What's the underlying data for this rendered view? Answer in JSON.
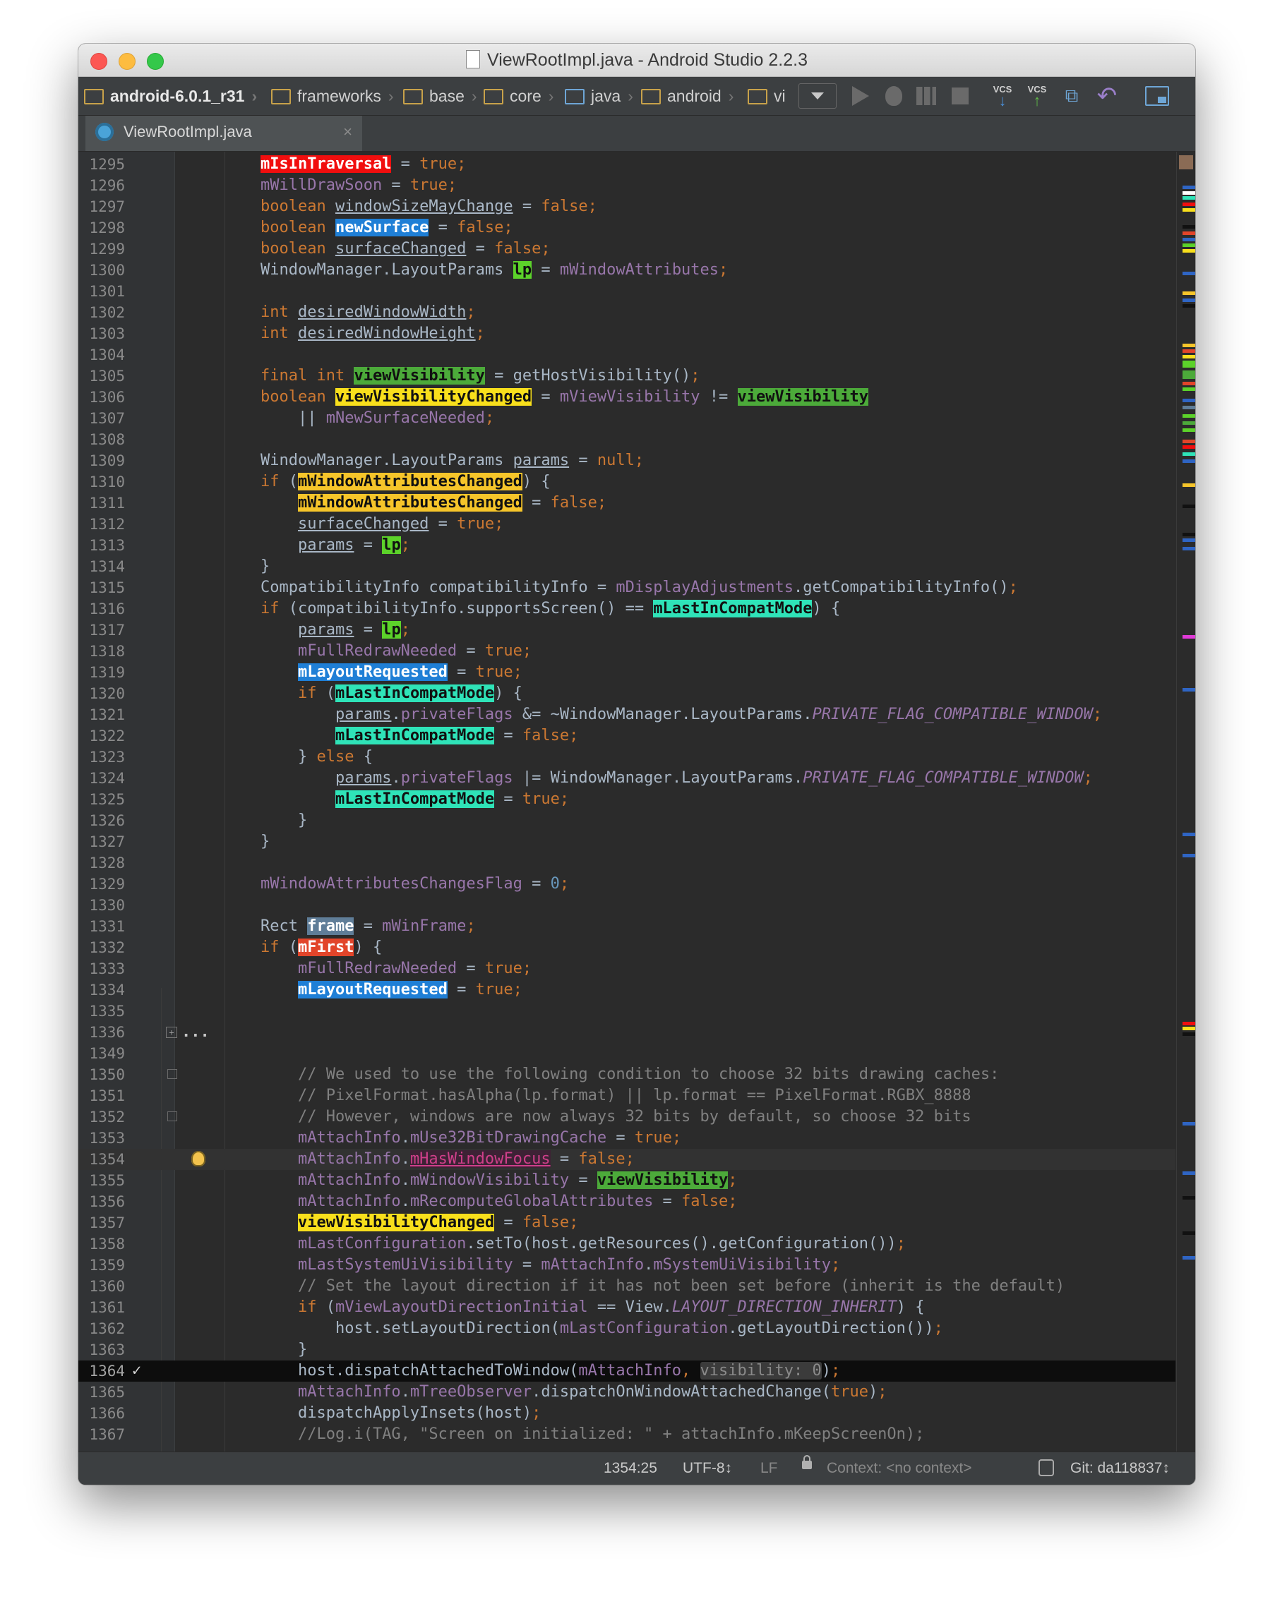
{
  "window": {
    "title": "ViewRootImpl.java - Android Studio 2.2.3"
  },
  "breadcrumbs": [
    {
      "label": "android-6.0.1_r31"
    },
    {
      "label": "frameworks"
    },
    {
      "label": "base"
    },
    {
      "label": "core"
    },
    {
      "label": "java"
    },
    {
      "label": "android"
    },
    {
      "label": "vi"
    }
  ],
  "toolbar": {
    "run_icon": "play-icon",
    "debug_icon": "bug-icon",
    "profile_icon": "profile-icon",
    "stop_icon": "stop-icon",
    "vcs_update": "VCS",
    "vcs_commit": "VCS",
    "history_icon": "history-icon",
    "revert_icon": "undo-icon",
    "structure_icon": "project-structure-icon"
  },
  "tab": {
    "label": "ViewRootImpl.java",
    "close": "×"
  },
  "editor": {
    "gutter_check": "✓",
    "fold_placeholder": "...",
    "lines": [
      {
        "n": "1295",
        "t": [
          [
            "h-red",
            "mIsInTraversal"
          ],
          [
            "",
            " = "
          ],
          [
            "kw",
            "true;"
          ]
        ]
      },
      {
        "n": "1296",
        "t": [
          [
            "fld",
            "mWillDrawSoon"
          ],
          [
            "",
            " = "
          ],
          [
            "kw",
            "true;"
          ]
        ]
      },
      {
        "n": "1297",
        "t": [
          [
            "kw",
            "boolean "
          ],
          [
            "u",
            "windowSizeMayChange"
          ],
          [
            "",
            " = "
          ],
          [
            "kw",
            "false;"
          ]
        ]
      },
      {
        "n": "1298",
        "t": [
          [
            "kw",
            "boolean "
          ],
          [
            "h-blue",
            "newSurface"
          ],
          [
            "",
            " = "
          ],
          [
            "kw",
            "false;"
          ]
        ]
      },
      {
        "n": "1299",
        "t": [
          [
            "kw",
            "boolean "
          ],
          [
            "u",
            "surfaceChanged"
          ],
          [
            "",
            " = "
          ],
          [
            "kw",
            "false;"
          ]
        ]
      },
      {
        "n": "1300",
        "t": [
          [
            "",
            "WindowManager.LayoutParams "
          ],
          [
            "h-lime",
            "lp"
          ],
          [
            "",
            " = "
          ],
          [
            "fld",
            "mWindowAttributes"
          ],
          [
            "kw",
            ";"
          ]
        ]
      },
      {
        "n": "1301",
        "t": []
      },
      {
        "n": "1302",
        "t": [
          [
            "kw",
            "int "
          ],
          [
            "u",
            "desiredWindowWidth"
          ],
          [
            "kw",
            ";"
          ]
        ]
      },
      {
        "n": "1303",
        "t": [
          [
            "kw",
            "int "
          ],
          [
            "u",
            "desiredWindowHeight"
          ],
          [
            "kw",
            ";"
          ]
        ]
      },
      {
        "n": "1304",
        "t": []
      },
      {
        "n": "1305",
        "t": [
          [
            "kw",
            "final int "
          ],
          [
            "h-green",
            "viewVisibility"
          ],
          [
            "",
            " = getHostVisibility()"
          ],
          [
            "kw",
            ";"
          ]
        ]
      },
      {
        "n": "1306",
        "t": [
          [
            "kw",
            "boolean "
          ],
          [
            "h-yellow",
            "viewVisibilityChanged"
          ],
          [
            "",
            " = "
          ],
          [
            "fld",
            "mViewVisibility"
          ],
          [
            "",
            " != "
          ],
          [
            "h-green",
            "viewVisibility"
          ]
        ]
      },
      {
        "n": "1307",
        "t": [
          [
            "",
            "    || "
          ],
          [
            "fld",
            "mNewSurfaceNeeded"
          ],
          [
            "kw",
            ";"
          ]
        ]
      },
      {
        "n": "1308",
        "t": []
      },
      {
        "n": "1309",
        "t": [
          [
            "",
            "WindowManager.LayoutParams "
          ],
          [
            "u",
            "params"
          ],
          [
            "",
            " = "
          ],
          [
            "kw",
            "null;"
          ]
        ]
      },
      {
        "n": "1310",
        "t": [
          [
            "kw",
            "if "
          ],
          [
            "",
            "("
          ],
          [
            "h-orange",
            "mWindowAttributesChanged"
          ],
          [
            "",
            ") {"
          ]
        ]
      },
      {
        "n": "1311",
        "t": [
          [
            "",
            "    "
          ],
          [
            "h-orange",
            "mWindowAttributesChanged"
          ],
          [
            "",
            " = "
          ],
          [
            "kw",
            "false;"
          ]
        ]
      },
      {
        "n": "1312",
        "t": [
          [
            "",
            "    "
          ],
          [
            "u",
            "surfaceChanged"
          ],
          [
            "",
            " = "
          ],
          [
            "kw",
            "true;"
          ]
        ]
      },
      {
        "n": "1313",
        "t": [
          [
            "",
            "    "
          ],
          [
            "u",
            "params"
          ],
          [
            "",
            " = "
          ],
          [
            "h-lime",
            "lp"
          ],
          [
            "kw",
            ";"
          ]
        ]
      },
      {
        "n": "1314",
        "t": [
          [
            "",
            "}"
          ]
        ]
      },
      {
        "n": "1315",
        "t": [
          [
            "",
            "CompatibilityInfo compatibilityInfo = "
          ],
          [
            "fld",
            "mDisplayAdjustments"
          ],
          [
            "",
            ".getCompatibilityInfo()"
          ],
          [
            "kw",
            ";"
          ]
        ]
      },
      {
        "n": "1316",
        "t": [
          [
            "kw",
            "if "
          ],
          [
            "",
            "(compatibilityInfo.supportsScreen() == "
          ],
          [
            "h-aqua",
            "mLastInCompatMode"
          ],
          [
            "",
            ") {"
          ]
        ]
      },
      {
        "n": "1317",
        "t": [
          [
            "",
            "    "
          ],
          [
            "u",
            "params"
          ],
          [
            "",
            " = "
          ],
          [
            "h-lime",
            "lp"
          ],
          [
            "kw",
            ";"
          ]
        ]
      },
      {
        "n": "1318",
        "t": [
          [
            "",
            "    "
          ],
          [
            "fld",
            "mFullRedrawNeeded"
          ],
          [
            "",
            " = "
          ],
          [
            "kw",
            "true;"
          ]
        ]
      },
      {
        "n": "1319",
        "t": [
          [
            "",
            "    "
          ],
          [
            "h-blue",
            "mLayoutRequested"
          ],
          [
            "",
            " = "
          ],
          [
            "kw",
            "true;"
          ]
        ]
      },
      {
        "n": "1320",
        "t": [
          [
            "",
            "    "
          ],
          [
            "kw",
            "if "
          ],
          [
            "",
            "("
          ],
          [
            "h-aqua",
            "mLastInCompatMode"
          ],
          [
            "",
            ") {"
          ]
        ]
      },
      {
        "n": "1321",
        "t": [
          [
            "",
            "        "
          ],
          [
            "u",
            "params"
          ],
          [
            "",
            "."
          ],
          [
            "fld",
            "privateFlags"
          ],
          [
            "",
            " &= ~WindowManager.LayoutParams."
          ],
          [
            "fld ital",
            "PRIVATE_FLAG_COMPATIBLE_WINDOW"
          ],
          [
            "kw",
            ";"
          ]
        ]
      },
      {
        "n": "1322",
        "t": [
          [
            "",
            "        "
          ],
          [
            "h-aqua",
            "mLastInCompatMode"
          ],
          [
            "",
            " = "
          ],
          [
            "kw",
            "false;"
          ]
        ]
      },
      {
        "n": "1323",
        "t": [
          [
            "",
            "    } "
          ],
          [
            "kw",
            "else "
          ],
          [
            "",
            "{"
          ]
        ]
      },
      {
        "n": "1324",
        "t": [
          [
            "",
            "        "
          ],
          [
            "u",
            "params"
          ],
          [
            "",
            "."
          ],
          [
            "fld",
            "privateFlags"
          ],
          [
            "",
            " |= WindowManager.LayoutParams."
          ],
          [
            "fld ital",
            "PRIVATE_FLAG_COMPATIBLE_WINDOW"
          ],
          [
            "kw",
            ";"
          ]
        ]
      },
      {
        "n": "1325",
        "t": [
          [
            "",
            "        "
          ],
          [
            "h-aqua",
            "mLastInCompatMode"
          ],
          [
            "",
            " = "
          ],
          [
            "kw",
            "true;"
          ]
        ]
      },
      {
        "n": "1326",
        "t": [
          [
            "",
            "    }"
          ]
        ]
      },
      {
        "n": "1327",
        "t": [
          [
            "",
            "}"
          ]
        ]
      },
      {
        "n": "1328",
        "t": []
      },
      {
        "n": "1329",
        "t": [
          [
            "fld",
            "mWindowAttributesChangesFlag"
          ],
          [
            "",
            " = "
          ],
          [
            "num",
            "0"
          ],
          [
            "kw",
            ";"
          ]
        ]
      },
      {
        "n": "1330",
        "t": []
      },
      {
        "n": "1331",
        "t": [
          [
            "",
            "Rect "
          ],
          [
            "h-steel",
            "frame"
          ],
          [
            "",
            " = "
          ],
          [
            "fld",
            "mWinFrame"
          ],
          [
            "kw",
            ";"
          ]
        ]
      },
      {
        "n": "1332",
        "t": [
          [
            "kw",
            "if "
          ],
          [
            "",
            "("
          ],
          [
            "h-redorange",
            "mFirst"
          ],
          [
            "",
            ") {"
          ]
        ]
      },
      {
        "n": "1333",
        "t": [
          [
            "",
            "    "
          ],
          [
            "fld",
            "mFullRedrawNeeded"
          ],
          [
            "",
            " = "
          ],
          [
            "kw",
            "true;"
          ]
        ]
      },
      {
        "n": "1334",
        "t": [
          [
            "",
            "    "
          ],
          [
            "h-blue",
            "mLayoutRequested"
          ],
          [
            "",
            " = "
          ],
          [
            "kw",
            "true;"
          ]
        ]
      },
      {
        "n": "1335",
        "t": []
      },
      {
        "n": "1336",
        "t": []
      },
      {
        "n": "1349",
        "t": []
      },
      {
        "n": "1350",
        "t": [
          [
            "",
            "    "
          ],
          [
            "cm",
            "// We used to use the following condition to choose 32 bits drawing caches:"
          ]
        ]
      },
      {
        "n": "1351",
        "t": [
          [
            "",
            "    "
          ],
          [
            "cm",
            "// PixelFormat.hasAlpha(lp.format) || lp.format == PixelFormat.RGBX_8888"
          ]
        ]
      },
      {
        "n": "1352",
        "t": [
          [
            "",
            "    "
          ],
          [
            "cm",
            "// However, windows are now always 32 bits by default, so choose 32 bits"
          ]
        ]
      },
      {
        "n": "1353",
        "t": [
          [
            "",
            "    "
          ],
          [
            "fld",
            "mAttachInfo"
          ],
          [
            "",
            "."
          ],
          [
            "fld",
            "mUse32BitDrawingCache"
          ],
          [
            "",
            " = "
          ],
          [
            "kw",
            "true;"
          ]
        ]
      },
      {
        "n": "1354",
        "t": [
          [
            "",
            "    "
          ],
          [
            "fld",
            "mAttachInfo"
          ],
          [
            "",
            "."
          ],
          [
            "h-magenta",
            "mHasWindowFocus"
          ],
          [
            "",
            " = "
          ],
          [
            "kw",
            "false;"
          ]
        ]
      },
      {
        "n": "1355",
        "t": [
          [
            "",
            "    "
          ],
          [
            "fld",
            "mAttachInfo"
          ],
          [
            "",
            "."
          ],
          [
            "fld",
            "mWindowVisibility"
          ],
          [
            "",
            " = "
          ],
          [
            "h-green",
            "viewVisibility"
          ],
          [
            "kw",
            ";"
          ]
        ]
      },
      {
        "n": "1356",
        "t": [
          [
            "",
            "    "
          ],
          [
            "fld",
            "mAttachInfo"
          ],
          [
            "",
            "."
          ],
          [
            "fld",
            "mRecomputeGlobalAttributes"
          ],
          [
            "",
            " = "
          ],
          [
            "kw",
            "false;"
          ]
        ]
      },
      {
        "n": "1357",
        "t": [
          [
            "",
            "    "
          ],
          [
            "h-yellow",
            "viewVisibilityChanged"
          ],
          [
            "",
            " = "
          ],
          [
            "kw",
            "false;"
          ]
        ]
      },
      {
        "n": "1358",
        "t": [
          [
            "",
            "    "
          ],
          [
            "fld",
            "mLastConfiguration"
          ],
          [
            "",
            ".setTo(host.getResources().getConfiguration())"
          ],
          [
            "kw",
            ";"
          ]
        ]
      },
      {
        "n": "1359",
        "t": [
          [
            "",
            "    "
          ],
          [
            "fld",
            "mLastSystemUiVisibility"
          ],
          [
            "",
            " = "
          ],
          [
            "fld",
            "mAttachInfo"
          ],
          [
            "",
            "."
          ],
          [
            "fld",
            "mSystemUiVisibility"
          ],
          [
            "kw",
            ";"
          ]
        ]
      },
      {
        "n": "1360",
        "t": [
          [
            "",
            "    "
          ],
          [
            "cm",
            "// Set the layout direction if it has not been set before (inherit is the default)"
          ]
        ]
      },
      {
        "n": "1361",
        "t": [
          [
            "",
            "    "
          ],
          [
            "kw",
            "if "
          ],
          [
            "",
            "("
          ],
          [
            "fld",
            "mViewLayoutDirectionInitial"
          ],
          [
            "",
            " == View."
          ],
          [
            "fld ital",
            "LAYOUT_DIRECTION_INHERIT"
          ],
          [
            "",
            ") {"
          ]
        ]
      },
      {
        "n": "1362",
        "t": [
          [
            "",
            "        host.setLayoutDirection("
          ],
          [
            "fld",
            "mLastConfiguration"
          ],
          [
            "",
            ".getLayoutDirection())"
          ],
          [
            "kw",
            ";"
          ]
        ]
      },
      {
        "n": "1363",
        "t": [
          [
            "",
            "    }"
          ]
        ]
      },
      {
        "n": "1364",
        "t": [
          [
            "",
            "    host.dispatchAttachedToWindow("
          ],
          [
            "fld",
            "mAttachInfo"
          ],
          [
            "kw",
            ", "
          ],
          [
            "hint",
            "visibility: 0"
          ],
          [
            "",
            ")"
          ],
          [
            "kw",
            ";"
          ]
        ]
      },
      {
        "n": "1365",
        "t": [
          [
            "",
            "    "
          ],
          [
            "fld",
            "mAttachInfo"
          ],
          [
            "",
            "."
          ],
          [
            "fld",
            "mTreeObserver"
          ],
          [
            "",
            ".dispatchOnWindowAttachedChange("
          ],
          [
            "kw",
            "true"
          ],
          [
            "",
            ")"
          ],
          [
            "kw",
            ";"
          ]
        ]
      },
      {
        "n": "1366",
        "t": [
          [
            "",
            "    dispatchApplyInsets(host)"
          ],
          [
            "kw",
            ";"
          ]
        ]
      },
      {
        "n": "1367",
        "t": [
          [
            "",
            "    "
          ],
          [
            "cm",
            "//Log.i(TAG, \"Screen on initialized: \" + attachInfo.mKeepScreenOn);"
          ]
        ]
      }
    ]
  },
  "status": {
    "position": "1354:25",
    "encoding": "UTF-8↕",
    "line_sep": "LF",
    "context": "Context: <no context>",
    "git": "Git: da118837↕"
  },
  "colors": {
    "editor_bg": "#2b2b2b",
    "keyword": "#cc7832",
    "field": "#9876aa",
    "comment": "#808080",
    "number": "#6897bb"
  }
}
